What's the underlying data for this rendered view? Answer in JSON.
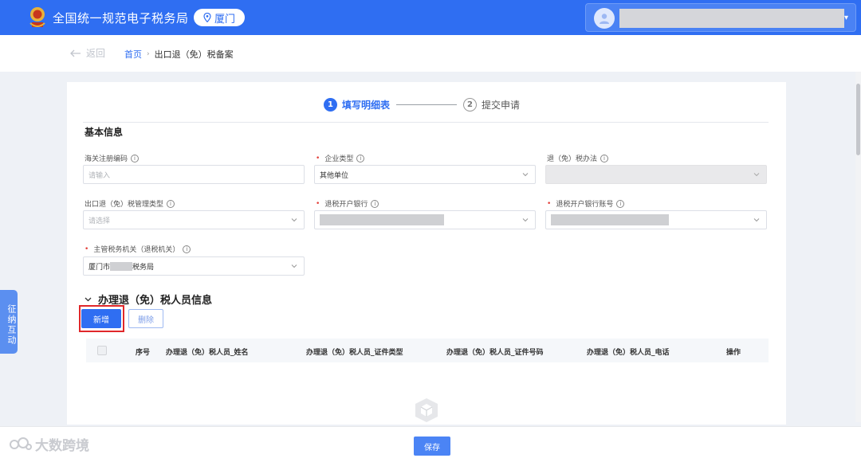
{
  "header": {
    "app_title": "全国统一规范电子税务局",
    "city": "厦门"
  },
  "breadcrumb": {
    "back_label": "返回",
    "home": "首页",
    "current": "出口退（免）税备案"
  },
  "steps": [
    {
      "num": "1",
      "label": "填写明细表",
      "active": true
    },
    {
      "num": "2",
      "label": "提交申请",
      "active": false
    }
  ],
  "basic_info": {
    "title": "基本信息",
    "fields": {
      "customs_code": {
        "label": "海关注册编码",
        "placeholder": "请输入"
      },
      "enterprise_type": {
        "label": "企业类型",
        "value": "其他单位"
      },
      "refund_method": {
        "label": "退（免）税办法",
        "value": ""
      },
      "mgmt_type": {
        "label": "出口退（免）税管理类型",
        "placeholder": "请选择"
      },
      "refund_bank": {
        "label": "退税开户银行"
      },
      "refund_account": {
        "label": "退税开户银行账号"
      },
      "tax_authority": {
        "label": "主管税务机关（退税机关）",
        "value_prefix": "厦门市",
        "value_suffix": "税务局"
      }
    }
  },
  "personnel": {
    "title": "办理退（免）税人员信息",
    "add_label": "新增",
    "delete_label": "删除",
    "columns": [
      "序号",
      "办理退（免）税人员_姓名",
      "办理退（免）税人员_证件类型",
      "办理退（免）税人员_证件号码",
      "办理退（免）税人员_电话",
      "操作"
    ]
  },
  "side_tab": "征纳互动",
  "footer": {
    "save_label": "保存",
    "watermark": "大数跨境"
  },
  "colors": {
    "primary": "#2f6ef2",
    "highlight_border": "#e0272a",
    "required": "#e3403a"
  },
  "icons": [
    "emblem-icon",
    "location-pin-icon",
    "avatar-icon",
    "arrow-left-icon",
    "info-icon",
    "chevron-down-icon",
    "empty-box-icon"
  ]
}
